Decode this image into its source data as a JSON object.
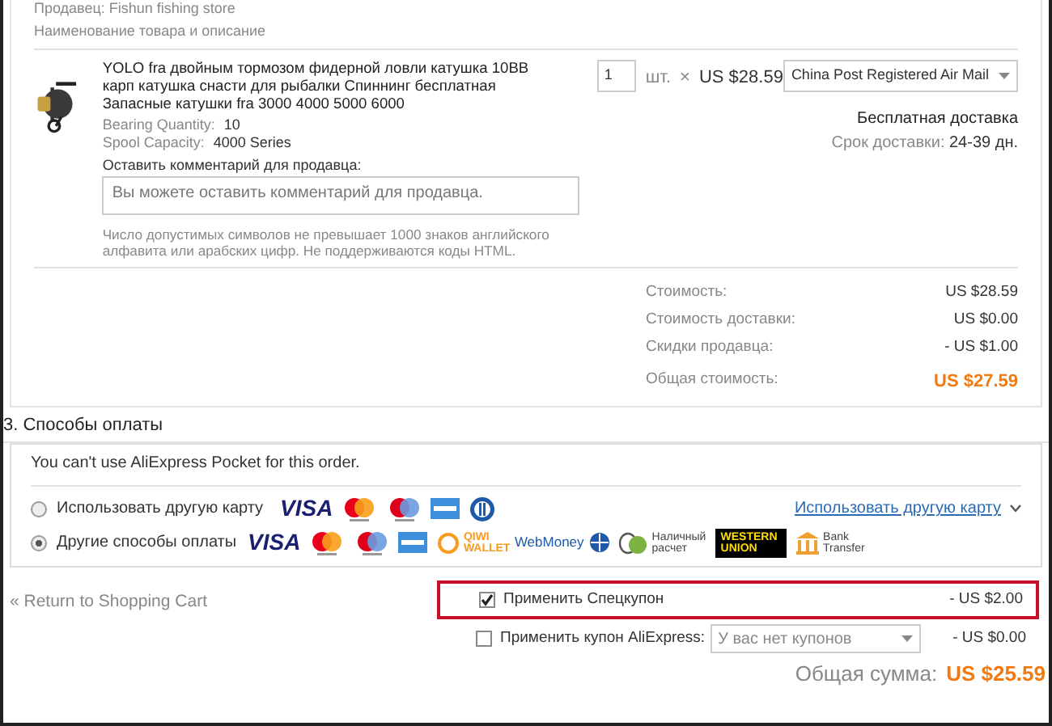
{
  "seller": "Продавец: Fishun fishing store",
  "column_header": "Наименование товара и описание",
  "item": {
    "title": "YOLO fra двойным тормозом фидерной ловли катушка 10BB карп катушка снасти для рыбалки Спиннинг бесплатная Запасные катушки fra 3000 4000 5000 6000",
    "attributes": [
      {
        "label": "Bearing Quantity:",
        "value": "10"
      },
      {
        "label": "Spool Capacity:",
        "value": "4000 Series"
      }
    ],
    "quantity": "1",
    "unit": "шт.",
    "times": "×",
    "price": "US $28.59",
    "shipping_method": "China Post Registered Air Mail",
    "shipping_cost": "Бесплатная доставка",
    "delivery_label": "Срок доставки:",
    "delivery_value": "24-39 дн.",
    "comment_label": "Оставить комментарий для продавца:",
    "comment_placeholder": "Вы можете оставить комментарий для продавца.",
    "comment_hint": "Число допустимых символов не превышает 1000 знаков английского алфавита или арабских цифр. Не поддерживаются коды HTML."
  },
  "summary": [
    {
      "label": "Стоимость:",
      "value": "US $28.59",
      "kind": "line"
    },
    {
      "label": "Стоимость доставки:",
      "value": "US $0.00",
      "kind": "line"
    },
    {
      "label": "Скидки продавца:",
      "value": "- US $1.00",
      "kind": "line"
    },
    {
      "label": "Общая стоимость:",
      "value": "US $27.59",
      "kind": "total"
    }
  ],
  "payment": {
    "heading": "3. Способы оплаты",
    "notice": "You can't use AliExpress Pocket for this order.",
    "methods": [
      {
        "label": "Использовать другую карту",
        "selected": false,
        "link": "Использовать другую карту",
        "logos": [
          {
            "kind": "visa",
            "text": "VISA"
          },
          {
            "kind": "mastercard"
          },
          {
            "kind": "maestro"
          },
          {
            "kind": "amex"
          },
          {
            "kind": "diners"
          }
        ]
      },
      {
        "label": "Другие способы оплаты",
        "selected": true,
        "logos": [
          {
            "kind": "visa",
            "text": "VISA"
          },
          {
            "kind": "mastercard"
          },
          {
            "kind": "maestro"
          },
          {
            "kind": "amex"
          },
          {
            "kind": "qiwi",
            "text": "QIWI WALLET"
          },
          {
            "kind": "webmoney",
            "text": "WebMoney"
          },
          {
            "kind": "cash",
            "text": "Наличный расчет"
          },
          {
            "kind": "western_union",
            "text": "WESTERN UNION"
          },
          {
            "kind": "bank",
            "text": "Bank Transfer"
          }
        ]
      }
    ]
  },
  "return_link": "« Return to Shopping Cart",
  "coupons": [
    {
      "label": "Применить Спецкупон",
      "checked": true,
      "highlighted": true,
      "value": "- US $2.00"
    },
    {
      "label": "Применить купон AliExpress:",
      "checked": false,
      "highlighted": false,
      "placeholder": "У вас нет купонов",
      "value": "- US $0.00"
    }
  ],
  "grand_total": {
    "label": "Общая сумма:",
    "value": "US $25.59"
  }
}
